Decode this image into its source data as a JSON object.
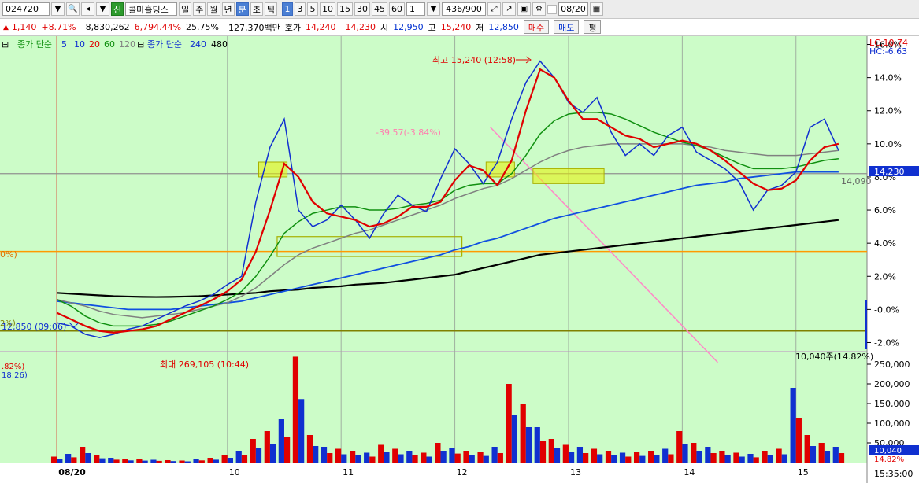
{
  "toolbar": {
    "code": "024720",
    "badge": "신",
    "name": "콜마홀딩스",
    "periods": [
      "일",
      "주",
      "월",
      "년",
      "분",
      "초",
      "틱"
    ],
    "intervals": [
      "1",
      "3",
      "5",
      "10",
      "15",
      "30",
      "45",
      "60"
    ],
    "unit": "1",
    "count": "436/900",
    "date": "08/20"
  },
  "quote": {
    "change": "1,140",
    "change_pct": "+8.71%",
    "volume": "8,830,262",
    "volume_pct": "6,794.44%",
    "turnover": "25.75%",
    "amount": "127,370백만",
    "hoga_label": "호가",
    "ask": "14,240",
    "bid": "14,230",
    "open_label": "시",
    "open": "12,950",
    "high_label": "고",
    "high": "15,240",
    "low_label": "저",
    "low": "12,850",
    "buy": "매수",
    "sell": "매도",
    "eval": "평"
  },
  "legend": {
    "price_label": "종가 단순",
    "ma": [
      "5",
      "10",
      "20",
      "60",
      "120"
    ],
    "ma_colors": [
      "#1030d0",
      "#1030d0",
      "#e00000",
      "#109010",
      "#808080"
    ],
    "long_label": "종가 단순",
    "long": [
      "240",
      "480"
    ]
  },
  "annotations": {
    "high": "최고 15,240 (12:58)",
    "low": "12,850 (09:06)",
    "pct": "-39.57(-3.84%)",
    "vol_max": "최대 269,105 (10:44)",
    "vol_now": "10,040주(14.82%)",
    "left_pct": "0%)",
    "left_vol1": ".82%)",
    "left_vol2": "18:26)",
    "left_low": "2%)",
    "line_14090": "14,090"
  },
  "right_axis": {
    "lc": "LC:10.74",
    "hc": "HC:-6.63",
    "current": "14,230",
    "vol_current": "10,040",
    "vol_pct": "14.82%",
    "time": "15:35:00"
  },
  "chart_data": {
    "type": "line",
    "ylabel": "",
    "y_ticks": [
      "16.0%",
      "14.0%",
      "12.0%",
      "10.0%",
      "8.0%",
      "6.0%",
      "4.0%",
      "2.0%",
      "-0.0%",
      "-2.0%"
    ],
    "ylim": [
      -2.5,
      16.5
    ],
    "vol_ticks": [
      "250,000",
      "200,000",
      "150,000",
      "100,000",
      "50,000"
    ],
    "vol_ylim": [
      0,
      280000
    ],
    "day_labels": [
      "08/20",
      "10",
      "11",
      "12",
      "13",
      "14",
      "15"
    ],
    "day_bounds": [
      0,
      12,
      20,
      28,
      36,
      44,
      52
    ],
    "x_range": [
      -4,
      57
    ],
    "ma5": [
      -0.8,
      -1.0,
      -1.5,
      -1.7,
      -1.5,
      -1.2,
      -1.0,
      -0.6,
      -0.2,
      0.2,
      0.5,
      0.9,
      1.5,
      2.0,
      6.5,
      9.8,
      11.5,
      6.0,
      5.0,
      5.4,
      6.3,
      5.4,
      4.3,
      5.8,
      6.9,
      6.3,
      5.9,
      7.9,
      9.7,
      8.8,
      7.6,
      8.9,
      11.5,
      13.7,
      15.0,
      14.0,
      12.5,
      11.9,
      12.8,
      10.7,
      9.3,
      10.0,
      9.3,
      10.5,
      11.0,
      9.5,
      9.0,
      8.5,
      7.7,
      6.0,
      7.2,
      7.5,
      8.3,
      11.0,
      11.5,
      9.6
    ],
    "ma20": [
      -0.2,
      -0.6,
      -1.0,
      -1.3,
      -1.4,
      -1.3,
      -1.2,
      -1.0,
      -0.6,
      -0.2,
      0.2,
      0.6,
      1.1,
      1.8,
      3.5,
      6.0,
      8.8,
      8.0,
      6.5,
      5.8,
      5.6,
      5.4,
      5.0,
      5.2,
      5.6,
      6.2,
      6.2,
      6.5,
      7.8,
      8.7,
      8.4,
      7.5,
      9.0,
      12.0,
      14.5,
      14.0,
      12.6,
      11.5,
      11.5,
      11.0,
      10.5,
      10.3,
      9.8,
      10.0,
      10.2,
      10.0,
      9.6,
      9.0,
      8.3,
      7.6,
      7.2,
      7.3,
      7.8,
      9.0,
      9.8,
      10.0
    ],
    "ma60": [
      0.6,
      0.2,
      -0.4,
      -0.8,
      -1.0,
      -1.0,
      -1.0,
      -0.9,
      -0.7,
      -0.4,
      -0.1,
      0.2,
      0.6,
      1.1,
      2.0,
      3.2,
      4.6,
      5.3,
      5.8,
      6.0,
      6.2,
      6.2,
      6.0,
      6.0,
      6.1,
      6.3,
      6.4,
      6.6,
      7.2,
      7.5,
      7.6,
      7.6,
      8.2,
      9.3,
      10.6,
      11.4,
      11.8,
      11.9,
      11.9,
      11.8,
      11.5,
      11.1,
      10.7,
      10.4,
      10.1,
      9.9,
      9.6,
      9.2,
      8.8,
      8.5,
      8.5,
      8.5,
      8.6,
      8.8,
      9.0,
      9.1
    ],
    "ma120": [
      0.6,
      0.4,
      0.2,
      -0.1,
      -0.3,
      -0.4,
      -0.5,
      -0.4,
      -0.3,
      -0.2,
      0.0,
      0.2,
      0.4,
      0.8,
      1.3,
      2.0,
      2.7,
      3.3,
      3.7,
      4.0,
      4.3,
      4.6,
      4.8,
      5.1,
      5.4,
      5.7,
      6.0,
      6.3,
      6.7,
      7.0,
      7.3,
      7.5,
      7.9,
      8.4,
      8.9,
      9.3,
      9.6,
      9.8,
      9.9,
      10.0,
      10.0,
      10.0,
      10.0,
      10.0,
      10.0,
      9.9,
      9.8,
      9.6,
      9.5,
      9.4,
      9.3,
      9.3,
      9.3,
      9.4,
      9.5,
      9.6
    ],
    "ma240": [
      0.5,
      0.4,
      0.3,
      0.2,
      0.1,
      0.0,
      0.0,
      0.0,
      0.0,
      0.1,
      0.2,
      0.3,
      0.4,
      0.5,
      0.7,
      0.9,
      1.1,
      1.3,
      1.5,
      1.7,
      1.9,
      2.1,
      2.3,
      2.5,
      2.7,
      2.9,
      3.1,
      3.3,
      3.6,
      3.8,
      4.1,
      4.3,
      4.6,
      4.9,
      5.2,
      5.5,
      5.7,
      5.9,
      6.1,
      6.3,
      6.5,
      6.7,
      6.9,
      7.1,
      7.3,
      7.5,
      7.6,
      7.7,
      7.9,
      8.0,
      8.1,
      8.2,
      8.3,
      8.3,
      8.3,
      8.3
    ],
    "ma480": [
      1.0,
      0.95,
      0.9,
      0.85,
      0.8,
      0.78,
      0.76,
      0.75,
      0.76,
      0.78,
      0.8,
      0.85,
      0.9,
      0.95,
      1.0,
      1.1,
      1.15,
      1.2,
      1.3,
      1.35,
      1.4,
      1.5,
      1.55,
      1.6,
      1.7,
      1.8,
      1.9,
      2.0,
      2.1,
      2.3,
      2.5,
      2.7,
      2.9,
      3.1,
      3.3,
      3.4,
      3.5,
      3.6,
      3.7,
      3.8,
      3.9,
      4.0,
      4.1,
      4.2,
      4.3,
      4.4,
      4.5,
      4.6,
      4.7,
      4.8,
      4.9,
      5.0,
      5.1,
      5.2,
      5.3,
      5.4
    ],
    "volume": [
      15000,
      22000,
      40000,
      18000,
      12000,
      9000,
      8000,
      7000,
      6000,
      5000,
      9000,
      12000,
      20000,
      30000,
      60000,
      80000,
      110000,
      269105,
      70000,
      40000,
      35000,
      30000,
      25000,
      45000,
      35000,
      30000,
      25000,
      50000,
      38000,
      30000,
      28000,
      40000,
      200000,
      150000,
      90000,
      60000,
      45000,
      40000,
      35000,
      30000,
      25000,
      28000,
      30000,
      35000,
      80000,
      50000,
      40000,
      30000,
      25000,
      22000,
      30000,
      35000,
      190000,
      70000,
      50000,
      40000
    ],
    "bounds": {
      "upper": 3.5,
      "lower": -1.3,
      "mid": 0.0
    },
    "high_value": 15240,
    "low_value": 12850,
    "vol_max_value": 269105
  }
}
